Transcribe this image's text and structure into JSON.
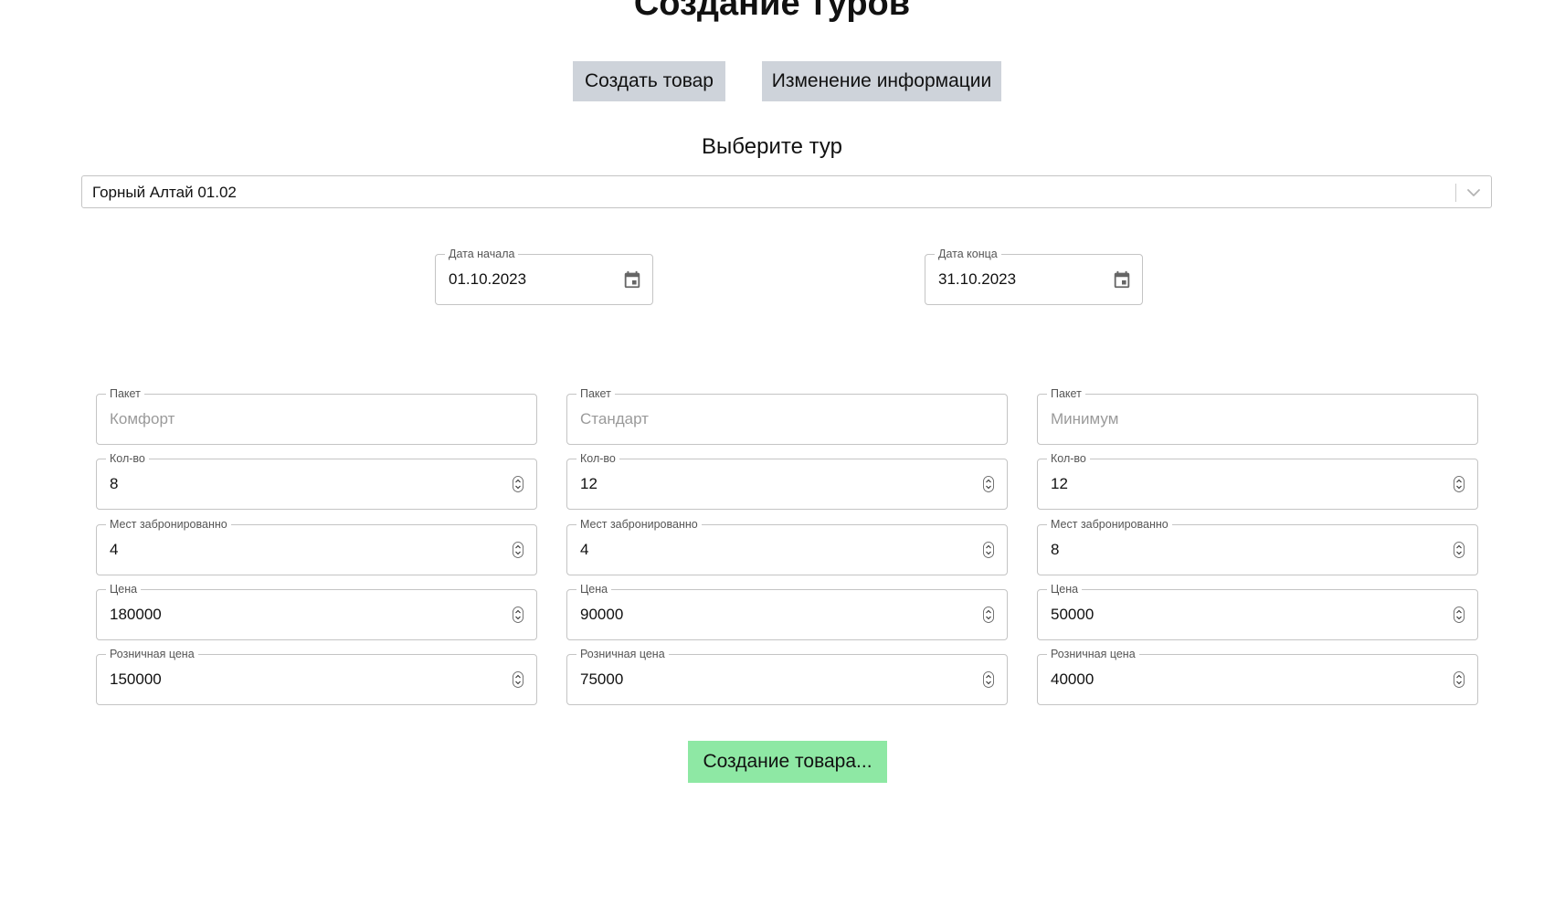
{
  "page_title": "Создание туров",
  "top_buttons": {
    "create_label": "Создать товар",
    "edit_label": "Изменение информации",
    "create_color": "#ced3da",
    "edit_color": "#ced3da"
  },
  "tour_select": {
    "heading": "Выберите тур",
    "selected": "Горный Алтай 01.02",
    "icon": "chevron-down-icon"
  },
  "dates": {
    "start": {
      "label": "Дата начала",
      "value": "01.10.2023",
      "icon": "calendar-icon"
    },
    "end": {
      "label": "Дата конца",
      "value": "31.10.2023",
      "icon": "calendar-icon"
    }
  },
  "packages": [
    {
      "package_label": "Пакет",
      "package_placeholder": "Комфорт",
      "qty_label": "Кол-во",
      "qty": "8",
      "booked_label": "Мест забронированно",
      "booked": "4",
      "price_label": "Цена",
      "price": "180000",
      "retail_label": "Розничная цена",
      "retail": "150000"
    },
    {
      "package_label": "Пакет",
      "package_placeholder": "Стандарт",
      "qty_label": "Кол-во",
      "qty": "12",
      "booked_label": "Мест забронированно",
      "booked": "4",
      "price_label": "Цена",
      "price": "90000",
      "retail_label": "Розничная цена",
      "retail": "75000"
    },
    {
      "package_label": "Пакет",
      "package_placeholder": "Минимум",
      "qty_label": "Кол-во",
      "qty": "12",
      "booked_label": "Мест забронированно",
      "booked": "8",
      "price_label": "Цена",
      "price": "50000",
      "retail_label": "Розничная цена",
      "retail": "40000"
    }
  ],
  "submit": {
    "label": "Создание товара...",
    "color": "#8ee8a4"
  }
}
